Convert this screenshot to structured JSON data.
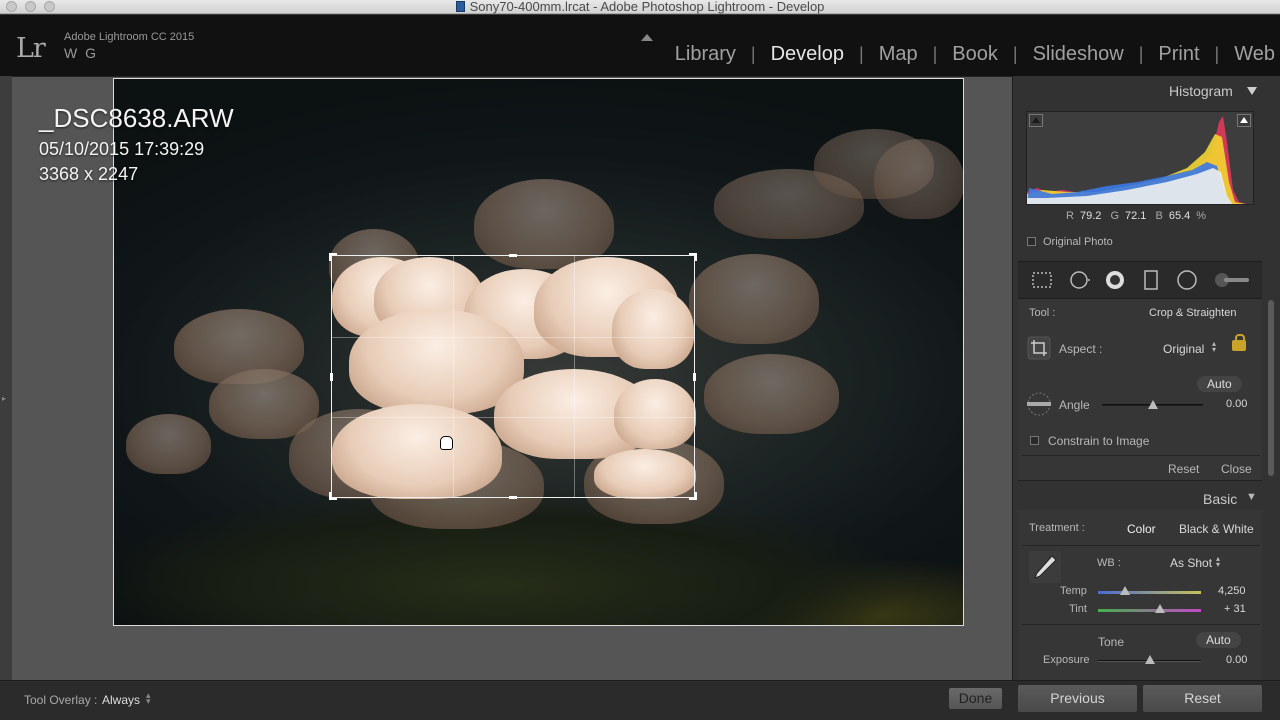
{
  "window": {
    "title": "Sony70-400mm.lrcat - Adobe Photoshop Lightroom - Develop"
  },
  "identity": {
    "logo": "Lr",
    "app": "Adobe Lightroom CC 2015",
    "user": "W G"
  },
  "modules": [
    "Library",
    "Develop",
    "Map",
    "Book",
    "Slideshow",
    "Print",
    "Web"
  ],
  "active_module": "Develop",
  "photo_overlay": {
    "filename": "_DSC8638.ARW",
    "datetime": "05/10/2015 17:39:29",
    "dimensions": "3368 x 2247"
  },
  "toolbar": {
    "tool_overlay_label": "Tool Overlay :",
    "tool_overlay_value": "Always",
    "done_label": "Done"
  },
  "histogram": {
    "title": "Histogram",
    "r_label": "R",
    "r_value": "79.2",
    "g_label": "G",
    "g_value": "72.1",
    "b_label": "B",
    "b_value": "65.4",
    "percent": "%",
    "original_photo_label": "Original Photo"
  },
  "crop_panel": {
    "tool_label": "Tool :",
    "tool_value": "Crop & Straighten",
    "aspect_label": "Aspect :",
    "aspect_value": "Original",
    "auto_label": "Auto",
    "angle_label": "Angle",
    "angle_value": "0.00",
    "angle_level": 0.5,
    "constrain_label": "Constrain to Image",
    "reset_label": "Reset",
    "close_label": "Close"
  },
  "basic_panel": {
    "title": "Basic",
    "treatment_label": "Treatment :",
    "treatment_color": "Color",
    "treatment_bw": "Black & White",
    "wb_label": "WB :",
    "wb_value": "As Shot",
    "temp_label": "Temp",
    "temp_value": "4,250",
    "temp_level": 0.26,
    "tint_label": "Tint",
    "tint_value": "+ 31",
    "tint_level": 0.6,
    "tone_label": "Tone",
    "tone_auto_label": "Auto",
    "exposure_label": "Exposure",
    "exposure_value": "0.00",
    "exposure_level": 0.5
  },
  "bottom_buttons": {
    "previous_label": "Previous",
    "reset_label": "Reset"
  },
  "icons": {
    "crop_overlay": "crop-overlay-icon",
    "spot_removal": "spot-removal-icon",
    "red_eye": "red-eye-icon",
    "graduated_filter": "graduated-filter-icon",
    "radial_filter": "radial-filter-icon",
    "adjustment_brush": "adjustment-brush-icon"
  },
  "colors": {
    "active_module": "#e6e6e6",
    "lock": "#c9a22a"
  }
}
